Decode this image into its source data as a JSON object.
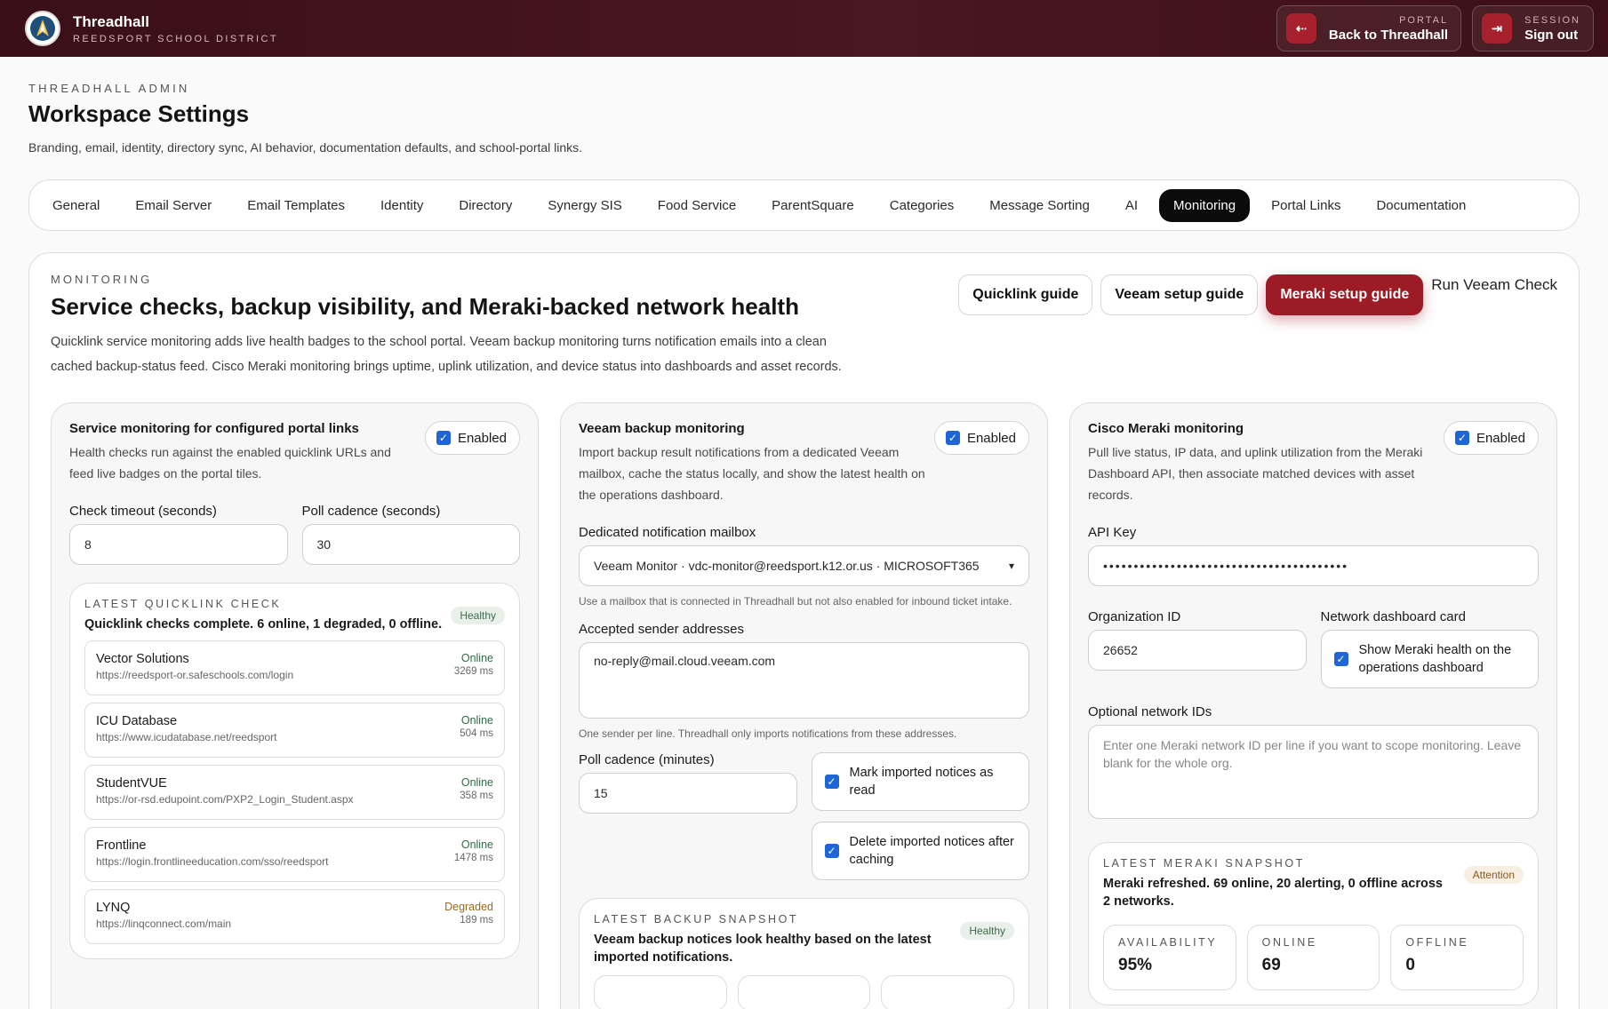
{
  "header": {
    "brand_name": "Threadhall",
    "brand_sub": "REEDSPORT SCHOOL DISTRICT",
    "portal_kicker": "PORTAL",
    "portal_label": "Back to Threadhall",
    "session_kicker": "SESSION",
    "session_label": "Sign out"
  },
  "page": {
    "kicker": "THREADHALL ADMIN",
    "title": "Workspace Settings",
    "description": "Branding, email, identity, directory sync, AI behavior, documentation defaults, and school-portal links."
  },
  "tabs": [
    "General",
    "Email Server",
    "Email Templates",
    "Identity",
    "Directory",
    "Synergy SIS",
    "Food Service",
    "ParentSquare",
    "Categories",
    "Message Sorting",
    "AI",
    "Monitoring",
    "Portal Links",
    "Documentation"
  ],
  "monitoring": {
    "kicker": "MONITORING",
    "title": "Service checks, backup visibility, and Meraki-backed network health",
    "description": "Quicklink service monitoring adds live health badges to the school portal. Veeam backup monitoring turns notification emails into a clean cached backup-status feed. Cisco Meraki monitoring brings uptime, uplink utilization, and device status into dashboards and asset records.",
    "guides": {
      "quicklink": "Quicklink guide",
      "veeam": "Veeam setup guide",
      "meraki": "Meraki setup guide",
      "run_veeam": "Run Veeam Check"
    }
  },
  "service": {
    "title": "Service monitoring for configured portal links",
    "enabled_label": "Enabled",
    "description": "Health checks run against the enabled quicklink URLs and feed live badges on the portal tiles.",
    "timeout_label": "Check timeout (seconds)",
    "timeout_value": "8",
    "poll_label": "Poll cadence (seconds)",
    "poll_value": "30",
    "snapshot": {
      "kicker": "LATEST QUICKLINK CHECK",
      "text": "Quicklink checks complete. 6 online, 1 degraded, 0 offline.",
      "badge": "Healthy"
    },
    "links": [
      {
        "name": "Vector Solutions",
        "url": "https://reedsport-or.safeschools.com/login",
        "status": "Online",
        "ms": "3269 ms"
      },
      {
        "name": "ICU Database",
        "url": "https://www.icudatabase.net/reedsport",
        "status": "Online",
        "ms": "504 ms"
      },
      {
        "name": "StudentVUE",
        "url": "https://or-rsd.edupoint.com/PXP2_Login_Student.aspx",
        "status": "Online",
        "ms": "358 ms"
      },
      {
        "name": "Frontline",
        "url": "https://login.frontlineeducation.com/sso/reedsport",
        "status": "Online",
        "ms": "1478 ms"
      },
      {
        "name": "LYNQ",
        "url": "https://linqconnect.com/main",
        "status": "Degraded",
        "ms": "189 ms"
      }
    ]
  },
  "veeam": {
    "title": "Veeam backup monitoring",
    "enabled_label": "Enabled",
    "description": "Import backup result notifications from a dedicated Veeam mailbox, cache the status locally, and show the latest health on the operations dashboard.",
    "mailbox_label": "Dedicated notification mailbox",
    "mailbox_value": "Veeam Monitor · vdc-monitor@reedsport.k12.or.us · MICROSOFT365",
    "mailbox_hint": "Use a mailbox that is connected in Threadhall but not also enabled for inbound ticket intake.",
    "senders_label": "Accepted sender addresses",
    "senders_value": "no-reply@mail.cloud.veeam.com",
    "senders_hint": "One sender per line. Threadhall only imports notifications from these addresses.",
    "poll_label": "Poll cadence (minutes)",
    "poll_value": "15",
    "mark_read_label": "Mark imported notices as read",
    "delete_label": "Delete imported notices after caching",
    "snapshot": {
      "kicker": "LATEST BACKUP SNAPSHOT",
      "text": "Veeam backup notices look healthy based on the latest imported notifications.",
      "badge": "Healthy"
    }
  },
  "meraki": {
    "title": "Cisco Meraki monitoring",
    "enabled_label": "Enabled",
    "description": "Pull live status, IP data, and uplink utilization from the Meraki Dashboard API, then associate matched devices with asset records.",
    "api_label": "API Key",
    "api_value": "••••••••••••••••••••••••••••••••••••••••",
    "org_label": "Organization ID",
    "org_value": "26652",
    "card_label": "Network dashboard card",
    "card_check_label": "Show Meraki health on the operations dashboard",
    "networks_label": "Optional network IDs",
    "networks_placeholder": "Enter one Meraki network ID per line if you want to scope monitoring. Leave blank for the whole org.",
    "snapshot": {
      "kicker": "LATEST MERAKI SNAPSHOT",
      "text": "Meraki refreshed. 69 online, 20 alerting, 0 offline across 2 networks.",
      "badge": "Attention",
      "stats": [
        {
          "label": "AVAILABILITY",
          "value": "95%"
        },
        {
          "label": "ONLINE",
          "value": "69"
        },
        {
          "label": "OFFLINE",
          "value": "0"
        }
      ]
    }
  }
}
